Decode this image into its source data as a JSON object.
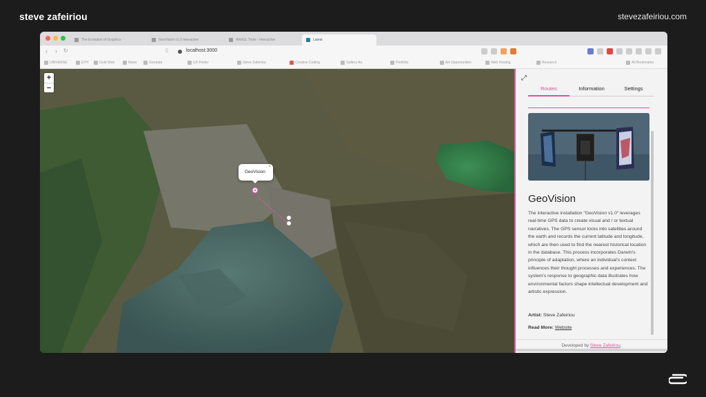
{
  "slide": {
    "author": "steve zafeiriou",
    "site": "stevezafeiriou.com"
  },
  "browser": {
    "tabs": [
      "The Evolution of Graphics",
      "GeoVision v1.0 Interactive",
      "WebGL Tools - Interactive",
      "Latest"
    ],
    "url": "localhost:3000",
    "bookmarks": [
      "UNIVERSE",
      "ETH",
      "Gold Web",
      "News",
      "Geodata",
      "UX Finder",
      "Steve Zafeiriou",
      "Creative Coding",
      "Gallery Art",
      "Portfolio",
      "Art Opportunities",
      "Web Hosting",
      "Research",
      "All Bookmarks"
    ]
  },
  "map": {
    "zoom_in": "+",
    "zoom_out": "−",
    "popup": {
      "text": "GeoVision",
      "close": "×"
    }
  },
  "panel": {
    "expand_icon": "⤢",
    "tabs": [
      {
        "label": "Routes",
        "active": true
      },
      {
        "label": "Information",
        "active": false
      },
      {
        "label": "Settings",
        "active": false
      }
    ],
    "title": "GeoVision",
    "description": "The interactive installation \"GeoVision v1.0\" leverages real-time GPS data to create visual and / or textual narratives. The GPS sensor locks into satellites around the earth and records the current latitude and longitude, which are then used to find the nearest historical location in the database. This process incorporates Darwin's principle of adaptation, where an individual's context influences their thought processes and experiences. The system's response to geographic data illustrates how environmental factors shape intellectual development and artistic expression.",
    "artist_label": "Artist:",
    "artist_value": "Steve Zafeiriou",
    "readmore_label": "Read More:",
    "readmore_link": "Website",
    "footer_prefix": "Developed by",
    "footer_link": "Steve Zafeiriou",
    "footer_suffix": "."
  },
  "colors": {
    "accent": "#e04f9c",
    "background": "#1c1c1c"
  }
}
